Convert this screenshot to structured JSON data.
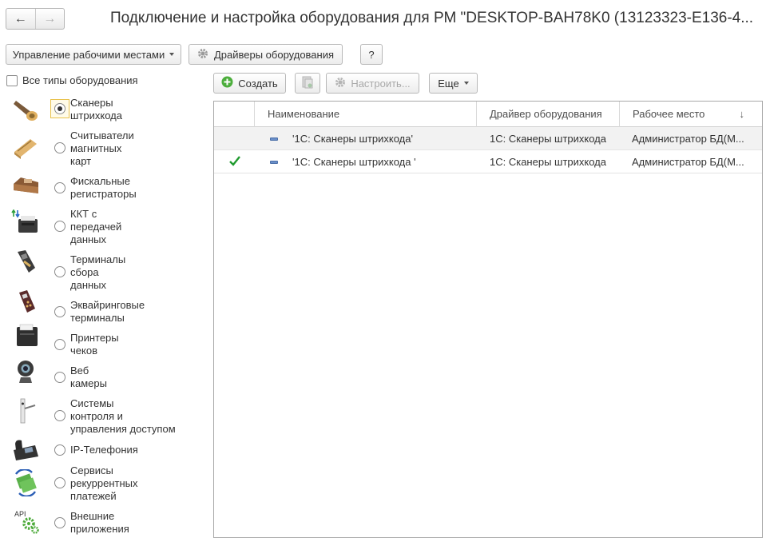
{
  "window": {
    "title": "Подключение и настройка оборудования для РМ \"DESKTOP-BAH78K0 (13123323-E136-4..."
  },
  "nav": {
    "back_icon": "arrow-left-icon",
    "forward_icon": "arrow-right-icon"
  },
  "toolbar_top": {
    "workplaces_label": "Управление рабочими местами",
    "drivers_label": "Драйверы оборудования",
    "help_label": "?"
  },
  "filter": {
    "all_types_label": "Все типы оборудования",
    "all_types_checked": false
  },
  "equipment_types": [
    {
      "label": "Сканеры\nштрихкода",
      "icon": "barcode-scanner-icon",
      "selected": true
    },
    {
      "label": "Считыватели\nмагнитных\nкарт",
      "icon": "card-reader-icon",
      "selected": false
    },
    {
      "label": "Фискальные\nрегистраторы",
      "icon": "fiscal-register-icon",
      "selected": false
    },
    {
      "label": "ККТ с\nпередачей\nданных",
      "icon": "kkt-icon",
      "selected": false
    },
    {
      "label": "Терминалы\nсбора\nданных",
      "icon": "data-terminal-icon",
      "selected": false
    },
    {
      "label": "Эквайринговые\nтерминалы",
      "icon": "acquiring-terminal-icon",
      "selected": false
    },
    {
      "label": "Принтеры\nчеков",
      "icon": "receipt-printer-icon",
      "selected": false
    },
    {
      "label": "Веб\nкамеры",
      "icon": "webcam-icon",
      "selected": false
    },
    {
      "label": "Системы\nконтроля и\nуправления доступом",
      "icon": "access-control-icon",
      "selected": false
    },
    {
      "label": "IP-Телефония",
      "icon": "ip-phone-icon",
      "selected": false
    },
    {
      "label": "Сервисы\nрекуррентных\nплатежей",
      "icon": "recurring-payments-icon",
      "selected": false
    },
    {
      "label": "Внешние\nприложения",
      "icon": "api-gears-icon",
      "selected": false
    }
  ],
  "toolbar_list": {
    "create_label": "Создать",
    "copy_icon": "copy-icon",
    "configure_label": "Настроить...",
    "more_label": "Еще"
  },
  "table": {
    "columns": [
      "Наименование",
      "Драйвер оборудования",
      "Рабочее место"
    ],
    "sort_icon": "sort-down-arrow-icon",
    "rows": [
      {
        "checked": false,
        "name": "'1С: Сканеры штрихкода'",
        "driver": "1С: Сканеры штрихкода",
        "workplace": "Администратор БД(М..."
      },
      {
        "checked": true,
        "name": "'1С: Сканеры штрихкода '",
        "driver": "1С: Сканеры штрихкода",
        "workplace": "Администратор БД(М..."
      }
    ]
  }
}
